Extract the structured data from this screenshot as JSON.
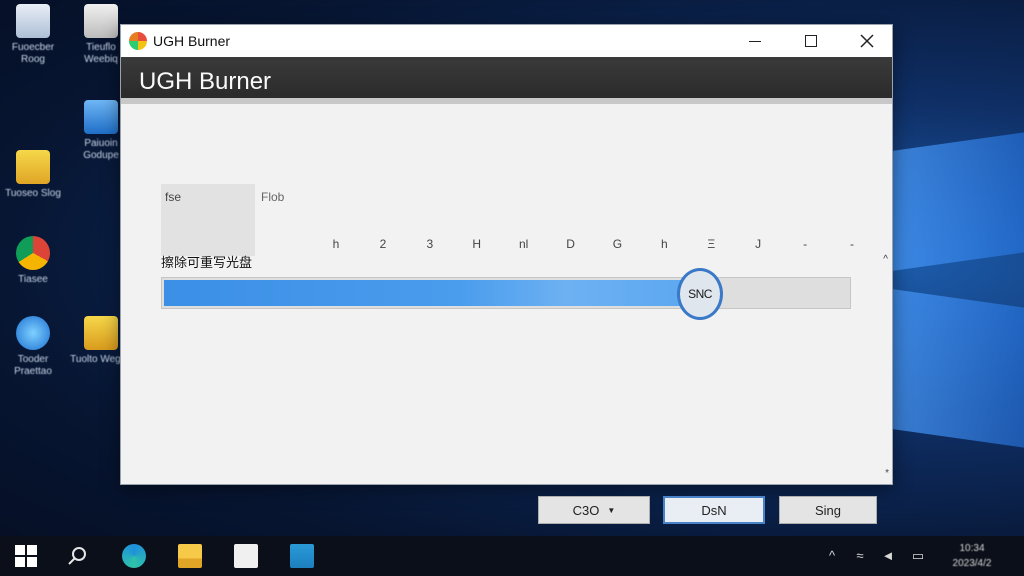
{
  "desktop": {
    "icons": [
      {
        "name": "desktop-icon-1",
        "label": "Fuoecber Roog"
      },
      {
        "name": "desktop-icon-2",
        "label": "Tieuflo Weebiq"
      },
      {
        "name": "desktop-icon-3",
        "label": "Tuoseo Slog"
      },
      {
        "name": "desktop-icon-4",
        "label": "Paiuoin Godupe"
      },
      {
        "name": "desktop-icon-5",
        "label": "Tiasee"
      },
      {
        "name": "desktop-icon-6",
        "label": "Tooder Praettao"
      },
      {
        "name": "desktop-icon-7",
        "label": "Tuolto Wegon"
      }
    ]
  },
  "window": {
    "title": "UGH Burner",
    "header": "UGH Burner",
    "tile_label": "fse",
    "side_label": "Flob",
    "ticks": [
      "h",
      "2",
      "3",
      "H",
      "nl",
      "D",
      "G",
      "h",
      "Ξ",
      "J",
      "-",
      "-"
    ],
    "task_label": "擦除可重写光盘",
    "progress": {
      "value": 0.785,
      "knob_label": "SNC"
    },
    "scroll_caret": "^",
    "buttons": {
      "b1": "C3O",
      "b1_caret": "▼",
      "b2": "DsN",
      "b3": "Sing"
    },
    "grip": "*"
  },
  "taskbar": {
    "clock_time": "10:34",
    "clock_date": "2023/4/2"
  },
  "colors": {
    "accent": "#3b8fe6",
    "header_band": "#2f2f2f",
    "focus_border": "#4a82c8"
  }
}
